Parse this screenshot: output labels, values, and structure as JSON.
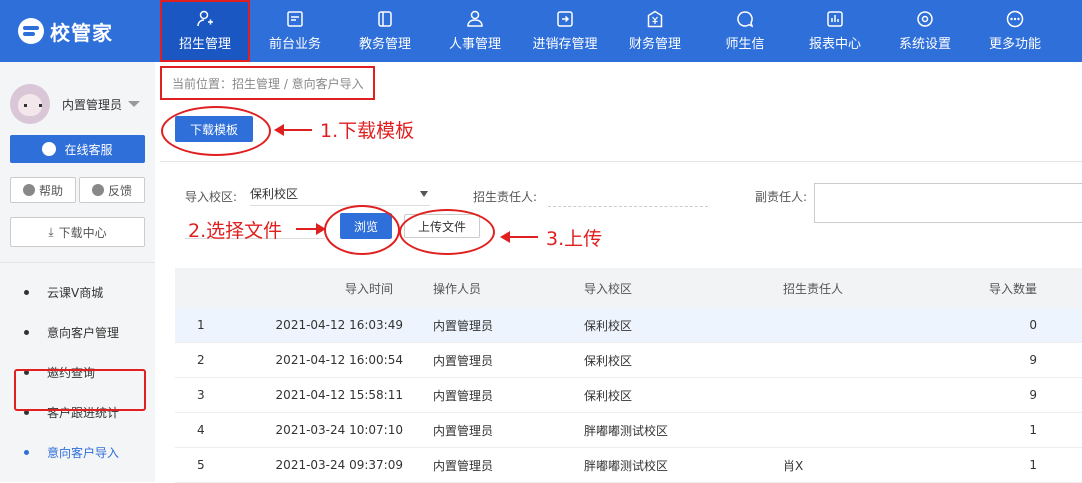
{
  "app": {
    "logo_text": "校管家"
  },
  "nav": [
    {
      "label": "招生管理",
      "icon": "user-plus-icon"
    },
    {
      "label": "前台业务",
      "icon": "monitor-icon"
    },
    {
      "label": "教务管理",
      "icon": "book-icon"
    },
    {
      "label": "人事管理",
      "icon": "person-icon"
    },
    {
      "label": "进销存管理",
      "icon": "login-icon"
    },
    {
      "label": "财务管理",
      "icon": "money-icon"
    },
    {
      "label": "师生信",
      "icon": "chat-icon"
    },
    {
      "label": "报表中心",
      "icon": "chart-icon"
    },
    {
      "label": "系统设置",
      "icon": "gear-icon"
    },
    {
      "label": "更多功能",
      "icon": "more-icon"
    }
  ],
  "sidebar": {
    "user_name": "内置管理员",
    "service_label": "在线客服",
    "help_label": "帮助",
    "feedback_label": "反馈",
    "download_label": "下载中心",
    "items": [
      {
        "label": "云课V商城"
      },
      {
        "label": "意向客户管理"
      },
      {
        "label": "邀约查询"
      },
      {
        "label": "客户跟进统计"
      },
      {
        "label": "意向客户导入"
      }
    ]
  },
  "breadcrumb": "当前位置：招生管理 / 意向客户导入",
  "buttons": {
    "download_template": "下载模板",
    "browse": "浏览",
    "upload": "上传文件"
  },
  "annotations": {
    "step1": "1.下载模板",
    "step2": "2.选择文件",
    "step3": "3.上传"
  },
  "form": {
    "campus_label": "导入校区:",
    "campus_value": "保利校区",
    "owner_label": "招生责任人:",
    "deputy_label": "副责任人:"
  },
  "table": {
    "headers": [
      "",
      "导入时间",
      "操作人员",
      "导入校区",
      "招生责任人",
      "导入数量"
    ],
    "rows": [
      [
        "1",
        "2021-04-12 16:03:49",
        "内置管理员",
        "保利校区",
        "",
        "0"
      ],
      [
        "2",
        "2021-04-12 16:00:54",
        "内置管理员",
        "保利校区",
        "",
        "9"
      ],
      [
        "3",
        "2021-04-12 15:58:11",
        "内置管理员",
        "保利校区",
        "",
        "9"
      ],
      [
        "4",
        "2021-03-24 10:07:10",
        "内置管理员",
        "胖嘟嘟测试校区",
        "",
        "1"
      ],
      [
        "5",
        "2021-03-24 09:37:09",
        "内置管理员",
        "胖嘟嘟测试校区",
        "肖X",
        "1"
      ]
    ]
  },
  "colors": {
    "primary": "#2f6fd9",
    "annotation": "#e02020"
  }
}
